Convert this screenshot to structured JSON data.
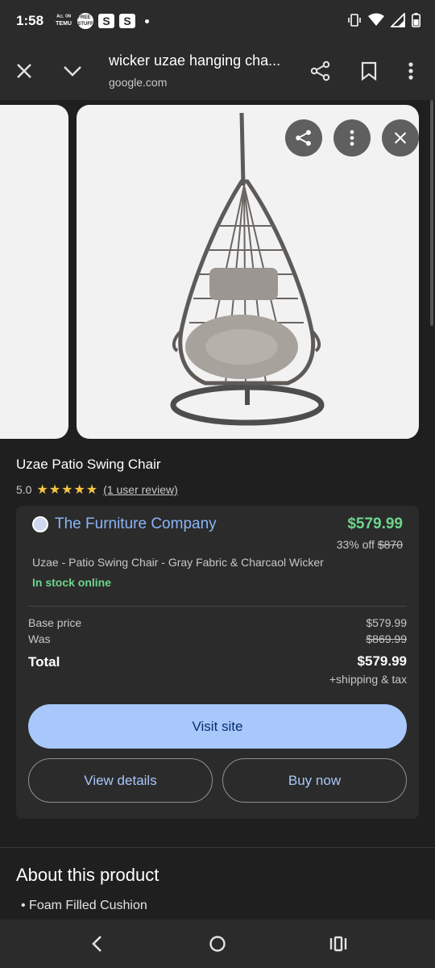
{
  "status_bar": {
    "time": "1:58",
    "temu_label": "ᴬᴸᴸ ᴼᴺ TEMU",
    "free_label": "FREE STUFF",
    "s1": "S",
    "s2": "S"
  },
  "top_bar": {
    "title": "wicker uzae hanging cha...",
    "domain": "google.com"
  },
  "product": {
    "title": "Uzae Patio Swing Chair",
    "rating": "5.0",
    "stars": "★★★★★",
    "review_text": "(1 user review)"
  },
  "merchant": {
    "name": "The Furniture Company",
    "price": "$579.99",
    "discount_text": "33% off",
    "original_price": "$870",
    "description": "Uzae - Patio Swing Chair - Gray Fabric & Charcaol Wicker",
    "stock": "In stock online",
    "base_price_label": "Base price",
    "base_price_value": "$579.99",
    "was_label": "Was",
    "was_value": "$869.99",
    "total_label": "Total",
    "total_value": "$579.99",
    "shipping": "+shipping & tax",
    "visit_label": "Visit site",
    "details_label": "View details",
    "buy_label": "Buy now"
  },
  "about": {
    "title": "About this product",
    "bullet_1": "Foam Filled Cushion"
  },
  "colors": {
    "background": "#1f1f1f",
    "surface": "#2b2b2b",
    "accent_blue": "#8ab4f8",
    "price_green": "#6dd58c",
    "button_fill": "#a8c7fa"
  }
}
